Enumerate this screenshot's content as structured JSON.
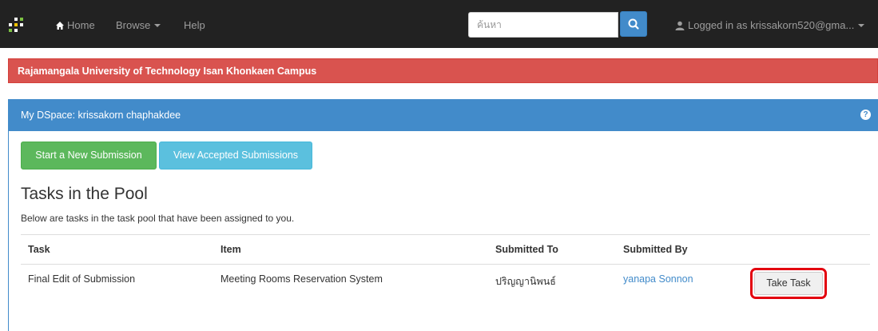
{
  "navbar": {
    "home_label": "Home",
    "browse_label": "Browse",
    "help_label": "Help",
    "search_placeholder": "ค้นหา",
    "login_label": "Logged in as krissakorn520@gma...",
    "icons": [
      "dspace-logo-icon",
      "home-icon",
      "caret-down-icon",
      "search-icon",
      "user-icon"
    ]
  },
  "banner": {
    "text": "Rajamangala University of Technology Isan Khonkaen Campus",
    "color": "#d9534f"
  },
  "panel": {
    "title": "My DSpace: krissakorn chaphakdee",
    "accent": "#428bca",
    "buttons": {
      "start": "Start a New Submission",
      "view": "View Accepted Submissions"
    }
  },
  "pool": {
    "title": "Tasks in the Pool",
    "description": "Below are tasks in the task pool that have been assigned to you.",
    "columns": [
      "Task",
      "Item",
      "Submitted To",
      "Submitted By"
    ],
    "rows": [
      {
        "task": "Final Edit of Submission",
        "item": "Meeting Rooms Reservation System",
        "submitted_to": "ปริญญานิพนธ์",
        "submitted_by": "yanapa Sonnon",
        "action": "Take Task"
      }
    ]
  }
}
